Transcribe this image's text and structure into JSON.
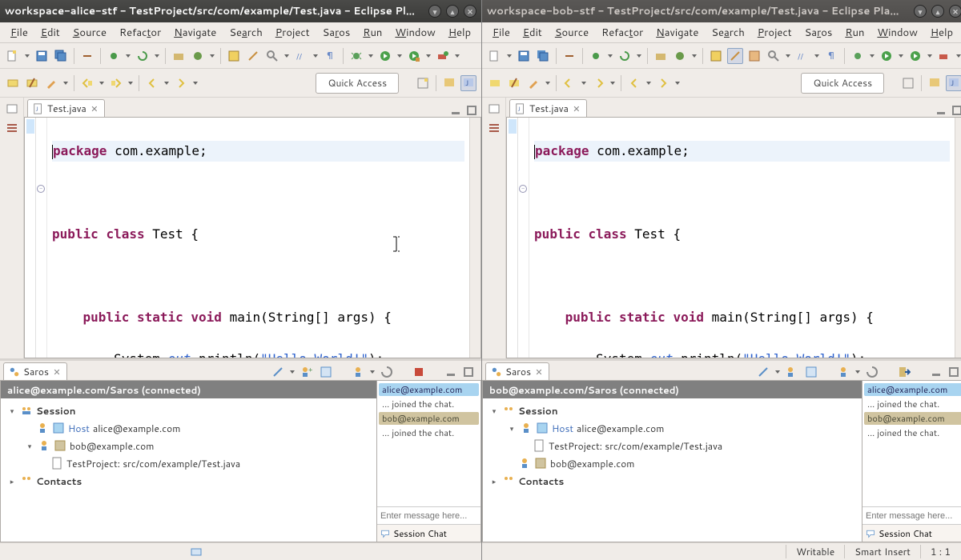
{
  "left": {
    "title": "workspace-alice-stf - TestProject/src/com/example/Test.java - Eclipse Pl...",
    "menus": [
      "File",
      "Edit",
      "Source",
      "Refactor",
      "Navigate",
      "Search",
      "Project",
      "Saros",
      "Run",
      "Window",
      "Help"
    ],
    "quick_access": "Quick Access",
    "tab_label": "Test.java",
    "saros_tab": "Saros",
    "saros_header": "alice@example.com/Saros (connected)",
    "session_label": "Session",
    "session_host_prefix": "Host",
    "session_host_user": "alice@example.com",
    "session_peer": "bob@example.com",
    "session_file": "TestProject: src/com/example/Test.java",
    "contacts_label": "Contacts",
    "chat_alice": "alice@example.com",
    "chat_bob": "bob@example.com",
    "chat_joined": "... joined the chat.",
    "chat_placeholder": "Enter message here...",
    "chat_tab": "Session Chat"
  },
  "right": {
    "title": "workspace-bob-stf - TestProject/src/com/example/Test.java - Eclipse Pla...",
    "menus": [
      "File",
      "Edit",
      "Source",
      "Refactor",
      "Navigate",
      "Search",
      "Project",
      "Saros",
      "Run",
      "Window",
      "Help"
    ],
    "quick_access": "Quick Access",
    "tab_label": "Test.java",
    "saros_tab": "Saros",
    "saros_header": "bob@example.com/Saros (connected)",
    "session_label": "Session",
    "session_host_prefix": "Host",
    "session_host_user": "alice@example.com",
    "session_file": "TestProject: src/com/example/Test.java",
    "session_peer": "bob@example.com",
    "contacts_label": "Contacts",
    "chat_alice": "alice@example.com",
    "chat_bob": "bob@example.com",
    "chat_joined": "... joined the chat.",
    "chat_placeholder": "Enter message here...",
    "chat_tab": "Session Chat"
  },
  "status": {
    "writable": "Writable",
    "insert": "Smart Insert",
    "pos": "1 : 1"
  },
  "code": {
    "l1a": "package",
    "l1b": " com.example;",
    "l2a": "public",
    "l2b": " ",
    "l2c": "class",
    "l2d": " Test {",
    "l3a": "    ",
    "l3b": "public",
    "l3c": " ",
    "l3d": "static",
    "l3e": " ",
    "l3f": "void",
    "l3g": " main(String[] args) {",
    "l4a": "        System.",
    "l4b": "out",
    "l4c": ".println(",
    "l4d": "\"Hello World!\"",
    "l4e": ");",
    "l5": "    }",
    "l6": "}"
  }
}
